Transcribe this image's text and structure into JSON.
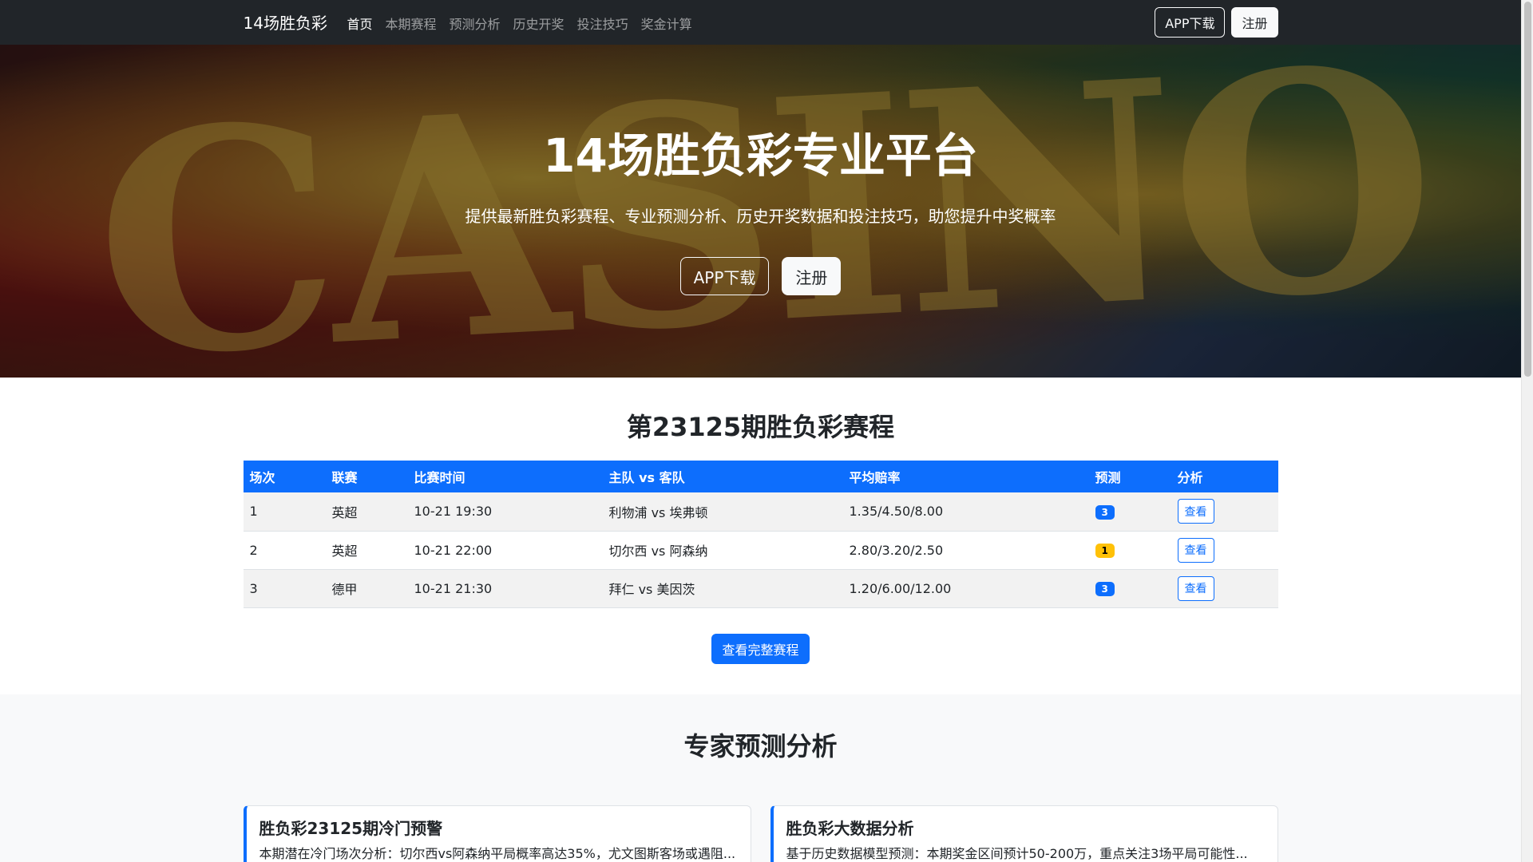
{
  "navbar": {
    "brand": "14场胜负彩",
    "links": [
      {
        "label": "首页",
        "active": true
      },
      {
        "label": "本期赛程",
        "active": false
      },
      {
        "label": "预测分析",
        "active": false
      },
      {
        "label": "历史开奖",
        "active": false
      },
      {
        "label": "投注技巧",
        "active": false
      },
      {
        "label": "奖金计算",
        "active": false
      }
    ],
    "app_button": "APP下载",
    "register_button": "注册"
  },
  "hero": {
    "background_text": "CASINO",
    "title": "14场胜负彩专业平台",
    "subtitle": "提供最新胜负彩赛程、专业预测分析、历史开奖数据和投注技巧，助您提升中奖概率",
    "app_button": "APP下载",
    "register_button": "注册"
  },
  "schedule": {
    "title": "第23125期胜负彩赛程",
    "columns": [
      "场次",
      "联赛",
      "比赛时间",
      "主队 vs 客队",
      "平均赔率",
      "预测",
      "分析"
    ],
    "rows": [
      {
        "no": "1",
        "league": "英超",
        "time": "10-21 19:30",
        "match": "利物浦 vs 埃弗顿",
        "odds": "1.35/4.50/8.00",
        "prediction": "3",
        "prediction_color": "#0d6efd",
        "action": "查看"
      },
      {
        "no": "2",
        "league": "英超",
        "time": "10-21 22:00",
        "match": "切尔西 vs 阿森纳",
        "odds": "2.80/3.20/2.50",
        "prediction": "1",
        "prediction_color": "#ffc107",
        "action": "查看"
      },
      {
        "no": "3",
        "league": "德甲",
        "time": "10-21 21:30",
        "match": "拜仁 vs 美因茨",
        "odds": "1.20/6.00/12.00",
        "prediction": "3",
        "prediction_color": "#0d6efd",
        "action": "查看"
      }
    ],
    "full_button": "查看完整赛程"
  },
  "expert": {
    "title": "专家预测分析",
    "cards": [
      {
        "title": "胜负彩23125期冷门预警",
        "text": "本期潜在冷门场次分析：切尔西vs阿森纳平局概率高达35%，尤文图斯客场或遇阻..."
      },
      {
        "title": "胜负彩大数据分析",
        "text": "基于历史数据模型预测：本期奖金区间预计50-200万，重点关注3场平局可能性..."
      }
    ]
  },
  "colors": {
    "navbar_bg": "#212529",
    "primary": "#0d6efd",
    "warning": "#ffc107",
    "light": "#f8f9fa"
  }
}
